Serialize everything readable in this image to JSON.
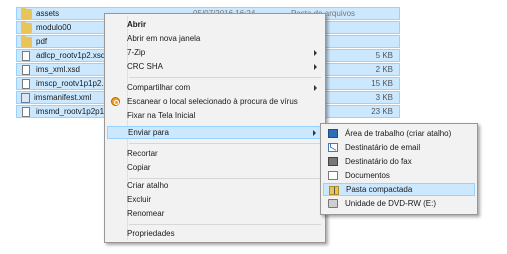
{
  "files": [
    {
      "name": "assets",
      "kind": "folder",
      "date": "05/07/2016 16:24",
      "type": "Pasta de arquivos",
      "size": ""
    },
    {
      "name": "modulo00",
      "kind": "folder",
      "date": "",
      "type": "ivos",
      "size": ""
    },
    {
      "name": "pdf",
      "kind": "folder",
      "date": "",
      "type": "ivos",
      "size": ""
    },
    {
      "name": "adlcp_rootv1p2.xsd",
      "kind": "doc",
      "date": "",
      "type": "",
      "size": "5 KB"
    },
    {
      "name": "ims_xml.xsd",
      "kind": "doc",
      "date": "",
      "type": "",
      "size": "2 KB"
    },
    {
      "name": "imscp_rootv1p1p2.",
      "kind": "doc",
      "date": "",
      "type": "",
      "size": "15 KB"
    },
    {
      "name": "imsmanifest.xml",
      "kind": "xml",
      "date": "",
      "type": "",
      "size": "3 KB"
    },
    {
      "name": "imsmd_rootv1p2p1",
      "kind": "doc",
      "date": "",
      "type": "",
      "size": "23 KB"
    }
  ],
  "context_menu": {
    "open": "Abrir",
    "open_new_window": "Abrir em nova janela",
    "seven_zip": "7-Zip",
    "crc_sha": "CRC SHA",
    "share_with": "Compartilhar com",
    "scan": "Escanear o local selecionado à procura de vírus",
    "pin_start": "Fixar na Tela Inicial",
    "send_to": "Enviar para",
    "cut": "Recortar",
    "copy": "Copiar",
    "create_shortcut": "Criar atalho",
    "delete": "Excluir",
    "rename": "Renomear",
    "properties": "Propriedades"
  },
  "send_to_menu": {
    "desktop": "Área de trabalho (criar atalho)",
    "mail": "Destinatário de email",
    "fax": "Destinatário do fax",
    "documents": "Documentos",
    "zip": "Pasta compactada",
    "dvd": "Unidade de DVD-RW (E:)"
  },
  "colors": {
    "selection": "#cce8ff",
    "selection_border": "#99d1ff",
    "menu_bg": "#f2f2f2"
  }
}
